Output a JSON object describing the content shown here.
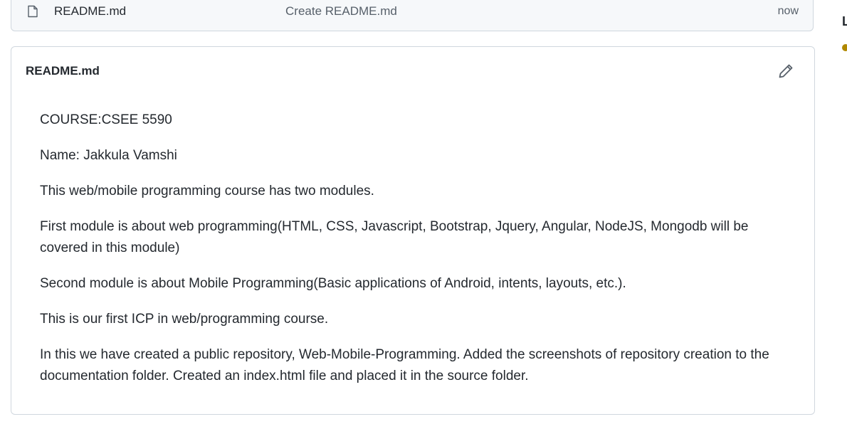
{
  "file_list": {
    "rows": [
      {
        "icon": "file-icon",
        "name": "README.md",
        "commit_message": "Create README.md",
        "age": "now"
      }
    ]
  },
  "sidebar": {
    "cropped_letter": "L"
  },
  "readme": {
    "title": "README.md",
    "edit_icon": "pencil-icon",
    "paragraphs": [
      "COURSE:CSEE 5590",
      "Name: Jakkula Vamshi",
      "This web/mobile programming course has two modules.",
      "First module is about web programming(HTML, CSS, Javascript, Bootstrap, Jquery, Angular, NodeJS, Mongodb will be covered in this module)",
      "Second module is about Mobile Programming(Basic applications of Android, intents, layouts, etc.).",
      "This is our first ICP in web/programming course.",
      "In this we have created a public repository, Web-Mobile-Programming. Added the screenshots of repository creation to the documentation folder. Created an index.html file and placed it in the source folder."
    ]
  },
  "colors": {
    "border": "#d0d7de",
    "text": "#24292f",
    "muted": "#57606a",
    "status_dot": "#b08800"
  }
}
